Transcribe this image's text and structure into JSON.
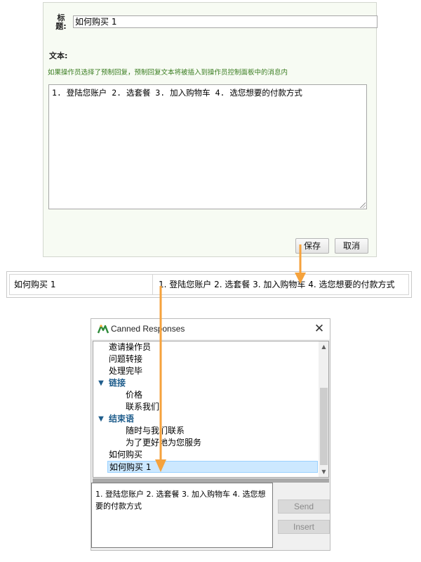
{
  "editor": {
    "title_label": "标题:",
    "title_value": "如何购买 1",
    "text_label": "文本:",
    "hint": "如果操作员选择了预制回复，预制回复文本将被插入到操作员控制面板中的消息内",
    "body_value": "1. 登陆您账户 2. 选套餐 3. 加入购物车 4. 选您想要的付款方式",
    "save_label": "保存",
    "cancel_label": "取消"
  },
  "table_row": {
    "name": "如何购买 1",
    "text": "1. 登陆您账户 2. 选套餐 3. 加入购物车 4. 选您想要的付款方式"
  },
  "dialog": {
    "title": "Canned Responses",
    "tree": {
      "item_invite": "邀请操作员",
      "item_transfer": "问题转接",
      "item_done": "处理完毕",
      "group_links": "链接",
      "item_price": "价格",
      "item_contact": "联系我们",
      "group_closing": "结束语",
      "item_anytime": "随时与我们联系",
      "item_better": "为了更好地为您服务",
      "item_howto": "如何购买",
      "item_howto1": "如何购买 1"
    },
    "preview_text": "1. 登陆您账户 2. 选套餐 3. 加入购物车 4. 选您想要的付款方式",
    "send_label": "Send",
    "insert_label": "Insert"
  },
  "icons": {
    "app": "canned-responses-app-icon",
    "close": "close-icon",
    "expand": "chevron-down-icon",
    "scroll_up": "scroll-up-icon",
    "scroll_down": "scroll-down-icon",
    "resize": "resize-grip-icon",
    "arrow": "arrow-down-icon"
  },
  "colors": {
    "panel_bg": "#f7fbf3",
    "hint_text": "#3a7d20",
    "group_text": "#1f5d8c",
    "selection": "#cce8ff",
    "arrow": "#f5a23c"
  }
}
